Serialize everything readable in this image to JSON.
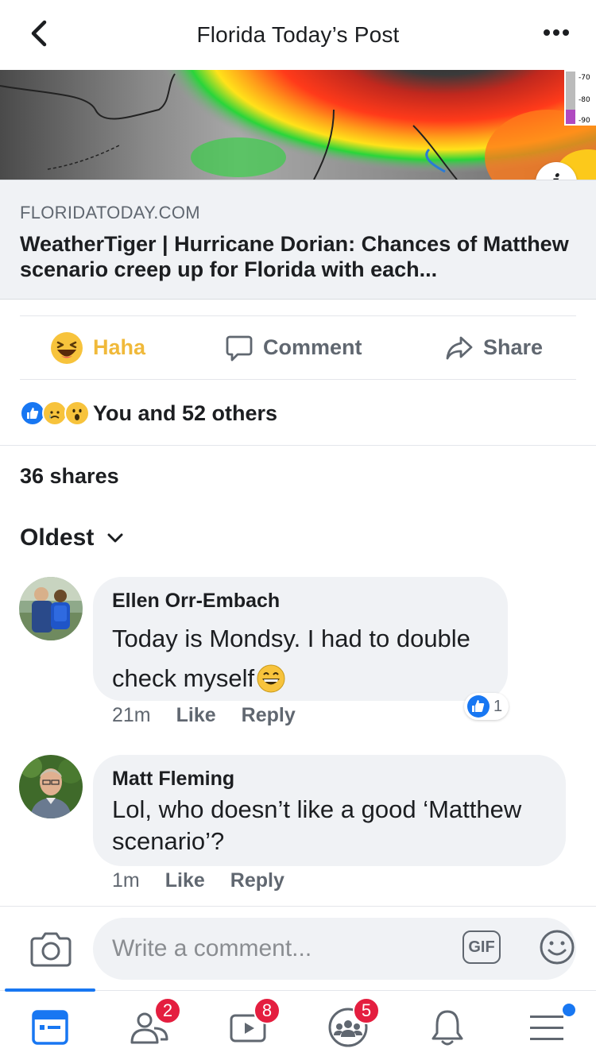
{
  "header": {
    "title": "Florida Today’s Post"
  },
  "link": {
    "domain": "FLORIDATODAY.COM",
    "title": "WeatherTiger | Hurricane Dorian: Chances of Matthew scenario creep up for Florida with each..."
  },
  "map": {
    "scale_labels": [
      "-70",
      "-80",
      "-90"
    ]
  },
  "actions": {
    "haha_label": "Haha",
    "comment_label": "Comment",
    "share_label": "Share",
    "haha_color": "#f0b93a"
  },
  "reactions": {
    "summary": "You and 52 others"
  },
  "shares": {
    "text": "36 shares"
  },
  "sort": {
    "label": "Oldest"
  },
  "comments": [
    {
      "name": "Ellen Orr-Embach",
      "line1": "Today is Mondsy. I had to double",
      "line2": "check myself",
      "time": "21m",
      "like": "Like",
      "reply": "Reply",
      "like_count": "1"
    },
    {
      "name": "Matt Fleming",
      "line1": "Lol, who doesn’t like a good ‘Matthew",
      "line2": "scenario’?",
      "time": "1m",
      "like": "Like",
      "reply": "Reply"
    }
  ],
  "composer": {
    "placeholder": "Write a comment...",
    "gif_label": "GIF"
  },
  "tabbar": {
    "friends_badge": "2",
    "watch_badge": "8",
    "groups_badge": "5",
    "accent": "#1877f2",
    "badge_color": "#e41e3f"
  }
}
